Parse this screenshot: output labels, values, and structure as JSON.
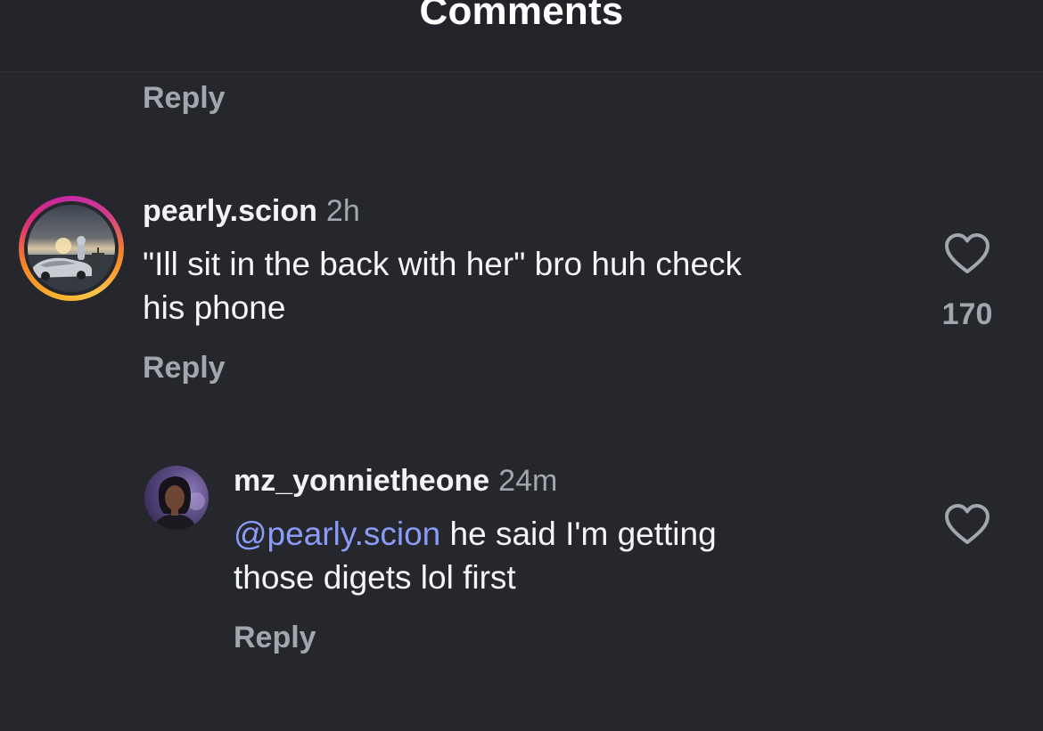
{
  "header": {
    "title": "Comments"
  },
  "top_reply_label": "Reply",
  "comments": [
    {
      "username": "pearly.scion",
      "time": "2h",
      "text_lines": [
        "\"Ill sit in the back with her\" bro huh check",
        "his phone"
      ],
      "likes": "170",
      "reply_label": "Reply",
      "avatar_icon": "profile-photo-sunset-car"
    },
    {
      "username": "mz_yonnietheone",
      "time": "24m",
      "mention": "@pearly.scion",
      "text_line1_rest": " he said I'm getting",
      "text_line2": "those digets lol first",
      "reply_label": "Reply",
      "avatar_icon": "profile-photo-woman"
    }
  ],
  "colors": {
    "background": "#25272c",
    "header_background": "#222429",
    "secondary_text": "#a3a6ad",
    "mention": "#8b9cf8",
    "story_ring": [
      "#f7b12b",
      "#dd2a7b",
      "#c32aa3"
    ]
  }
}
